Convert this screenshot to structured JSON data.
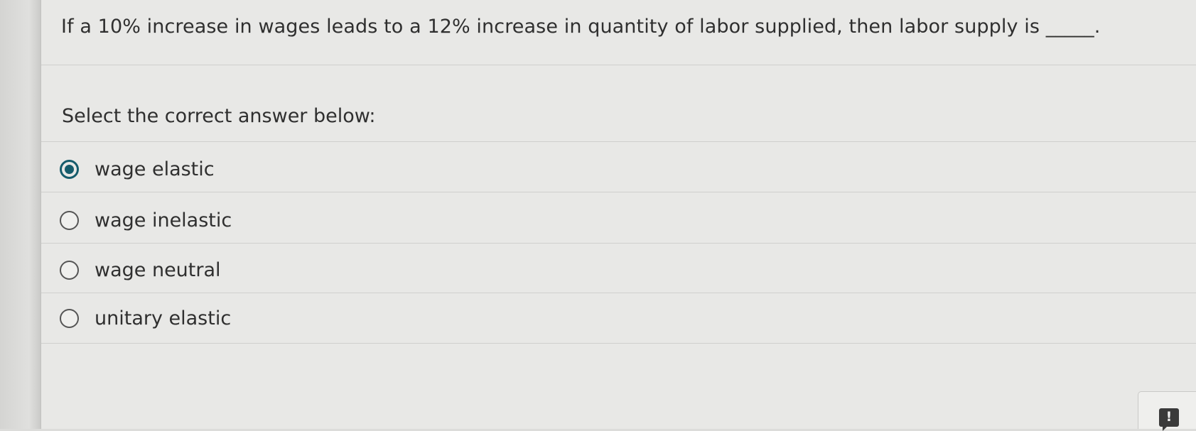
{
  "question": {
    "text": "If a 10% increase in wages leads to a 12% increase in quantity of labor supplied, then labor supply is _____."
  },
  "prompt": "Select the correct answer below:",
  "options": [
    {
      "label": "wage elastic",
      "selected": true
    },
    {
      "label": "wage inelastic",
      "selected": false
    },
    {
      "label": "wage neutral",
      "selected": false
    },
    {
      "label": "unitary elastic",
      "selected": false
    }
  ],
  "feedback": {
    "icon": "exclamation-icon",
    "glyph": "!"
  },
  "colors": {
    "accent": "#155b6b",
    "text": "#2f2f2f",
    "background": "#e8e8e6"
  }
}
